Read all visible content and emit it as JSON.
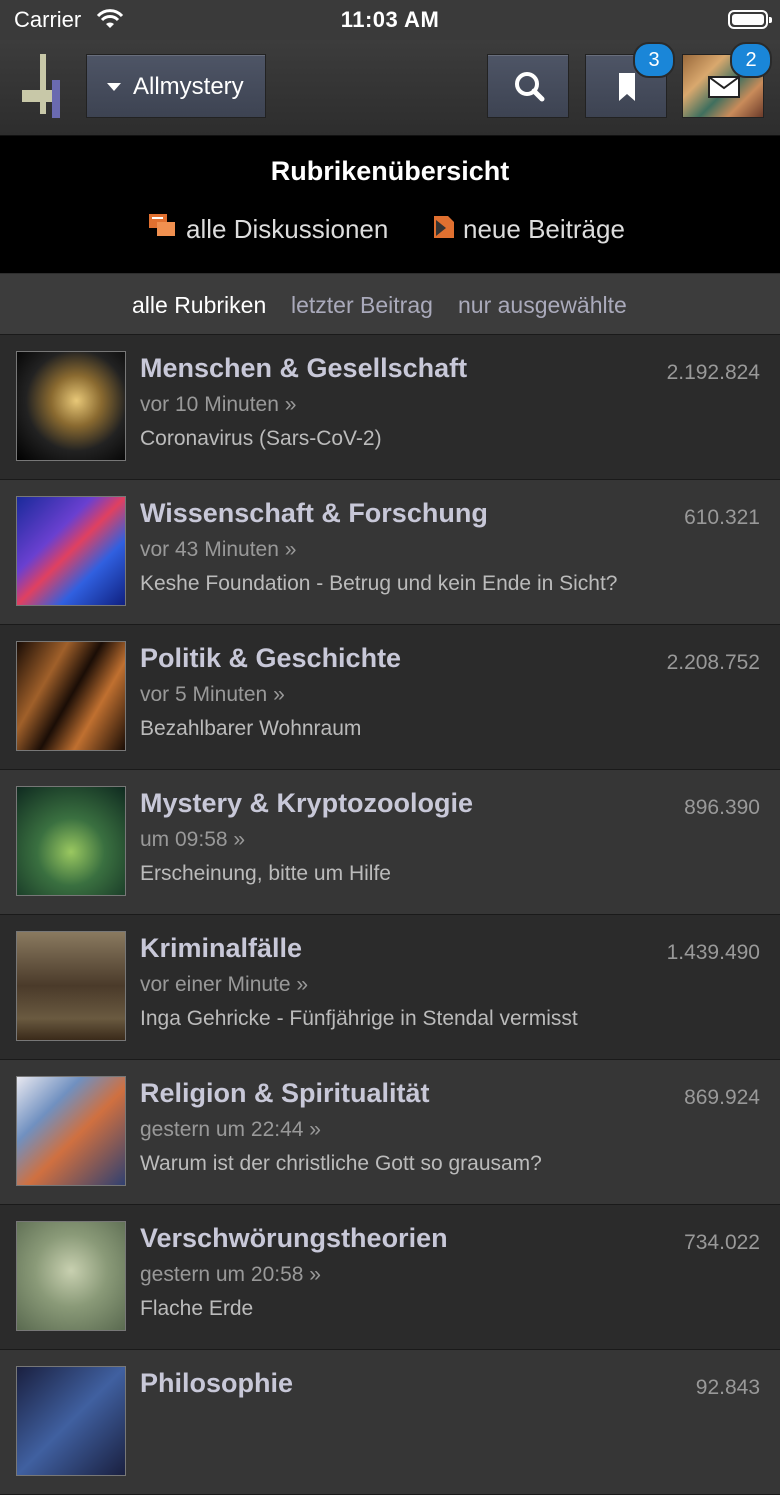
{
  "status": {
    "carrier": "Carrier",
    "time": "11:03 AM"
  },
  "navbar": {
    "forum_label": "Allmystery",
    "bookmark_badge": "3",
    "message_badge": "2"
  },
  "header": {
    "title": "Rubrikenübersicht",
    "link_discussions": "alle Diskussionen",
    "link_new_posts": "neue Beiträge"
  },
  "filters": {
    "all": "alle Rubriken",
    "latest": "letzter Beitrag",
    "selected": "nur ausgewählte"
  },
  "categories": [
    {
      "title": "Menschen & Gesellschaft",
      "count": "2.192.824",
      "time": "vor 10 Minuten »",
      "topic": "Coronavirus (Sars-CoV-2)"
    },
    {
      "title": "Wissenschaft & Forschung",
      "count": "610.321",
      "time": "vor 43 Minuten »",
      "topic": "Keshe Foundation - Betrug und kein Ende in Sicht?"
    },
    {
      "title": "Politik & Geschichte",
      "count": "2.208.752",
      "time": "vor 5 Minuten »",
      "topic": "Bezahlbarer Wohnraum"
    },
    {
      "title": "Mystery & Kryptozoologie",
      "count": "896.390",
      "time": "um 09:58 »",
      "topic": "Erscheinung, bitte um Hilfe"
    },
    {
      "title": "Kriminalfälle",
      "count": "1.439.490",
      "time": "vor einer Minute »",
      "topic": "Inga Gehricke - Fünfjährige in Stendal vermisst"
    },
    {
      "title": "Religion & Spiritualität",
      "count": "869.924",
      "time": "gestern um 22:44 »",
      "topic": "Warum ist der christliche Gott so grausam?"
    },
    {
      "title": "Verschwörungstheorien",
      "count": "734.022",
      "time": "gestern um 20:58 »",
      "topic": "Flache Erde"
    },
    {
      "title": "Philosophie",
      "count": "92.843",
      "time": "",
      "topic": ""
    }
  ]
}
